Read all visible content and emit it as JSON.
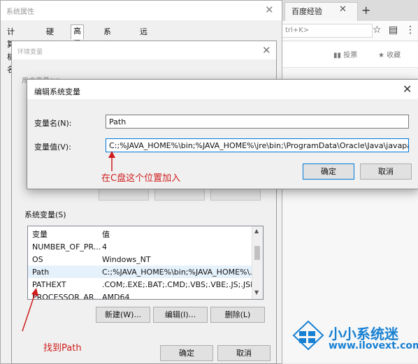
{
  "system_properties": {
    "title": "系统属性",
    "tabs": [
      {
        "label": "计算机名"
      },
      {
        "label": "硬件"
      },
      {
        "label": "高级"
      },
      {
        "label": "系统保护"
      },
      {
        "label": "远程"
      }
    ]
  },
  "env_window": {
    "title": "环境变量",
    "user_vars_fragment": "用户变量(U)",
    "system_vars_label": "系统变量(S)",
    "columns": {
      "name": "变量",
      "value": "值"
    },
    "rows": [
      {
        "name": "NUMBER_OF_PR...",
        "value": "4"
      },
      {
        "name": "OS",
        "value": "Windows_NT"
      },
      {
        "name": "Path",
        "value": "C:;%JAVA_HOME%\\bin;%JAVA_HOME%\\..."
      },
      {
        "name": "PATHEXT",
        "value": ".COM;.EXE;.BAT;.CMD;.VBS;.VBE;.JS;.JSE;..."
      },
      {
        "name": "PROCESSOR_AR...",
        "value": "AMD64"
      }
    ],
    "new_button": "新建(W)...",
    "edit_button": "编辑(I)...",
    "delete_button": "删除(L)",
    "ok_button": "确定",
    "cancel_button": "取消"
  },
  "edit_dialog": {
    "title": "编辑系统变量",
    "name_label": "变量名(N):",
    "name_value": "Path",
    "value_label": "变量值(V):",
    "value_value": "C:;%JAVA_HOME%\\bin;%JAVA_HOME%\\jre\\bin;\\ProgramData\\Oracle\\Java\\javapath;%S",
    "ok_button": "确定",
    "cancel_button": "取消"
  },
  "annotations": {
    "add_here": "在C盘这个位置加入",
    "find_path": "找到Path",
    "color": "#d01c1c"
  },
  "browser": {
    "tab_title": "百度经验",
    "address_hint": "trl+K>",
    "toolbar_btn1": "投票",
    "toolbar_btn2": "收藏"
  },
  "watermark": {
    "brand": "小小系统迷",
    "url": "www.ilovext.com"
  }
}
